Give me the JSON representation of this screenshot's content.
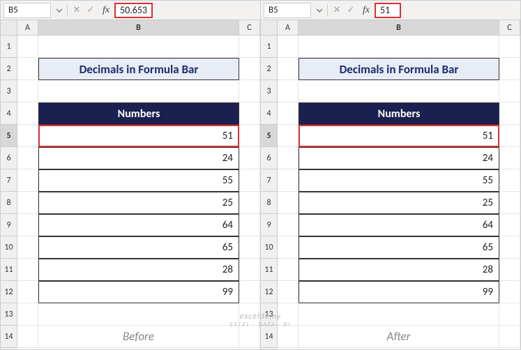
{
  "panels": [
    {
      "namebox": "B5",
      "formula_value": "50.653",
      "caption": "Before"
    },
    {
      "namebox": "B5",
      "formula_value": "51",
      "caption": "After"
    }
  ],
  "title": "Decimals in Formula Bar",
  "column_header": "Numbers",
  "col_labels": {
    "A": "A",
    "B": "B",
    "C": "C"
  },
  "row_labels": [
    "1",
    "2",
    "3",
    "4",
    "5",
    "6",
    "7",
    "8",
    "9",
    "10",
    "11",
    "12",
    "13",
    "14"
  ],
  "selected_row": "5",
  "selected_col": "B",
  "values": [
    "51",
    "24",
    "55",
    "25",
    "64",
    "65",
    "28",
    "99"
  ],
  "fx_label": "fx",
  "watermark": {
    "main": "exceldemy",
    "sub": "EXCEL · DATA · BI"
  }
}
